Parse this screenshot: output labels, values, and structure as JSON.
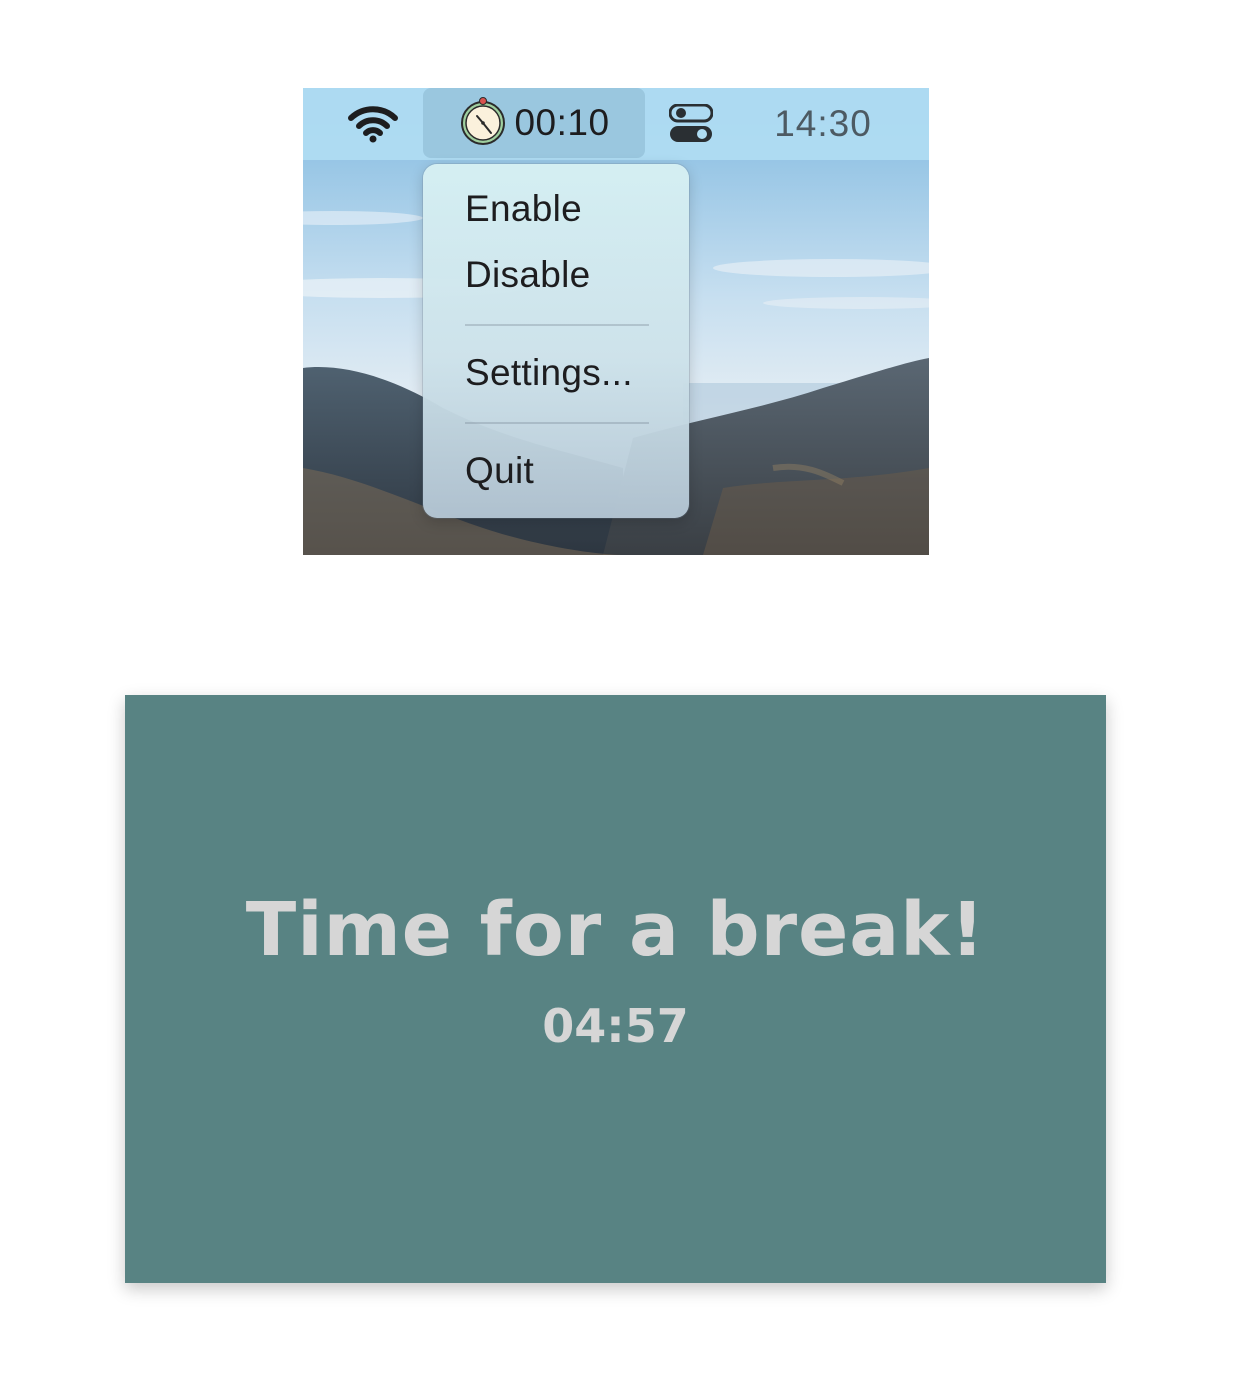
{
  "menubar": {
    "wifi_icon": "wifi-icon",
    "timer_icon": "stopwatch-icon",
    "timer_label": "00:10",
    "control_center_icon": "control-center-icon",
    "clock": "14:30",
    "colors": {
      "bar": "#afdcf2",
      "highlight": "#82afc8"
    }
  },
  "menu": {
    "items": [
      {
        "label": "Enable"
      },
      {
        "label": "Disable"
      },
      {
        "label": "Settings..."
      },
      {
        "label": "Quit"
      }
    ]
  },
  "break_window": {
    "title": "Time for a break!",
    "countdown": "04:57",
    "colors": {
      "background": "#588383",
      "text": "#d6d6d6"
    }
  }
}
